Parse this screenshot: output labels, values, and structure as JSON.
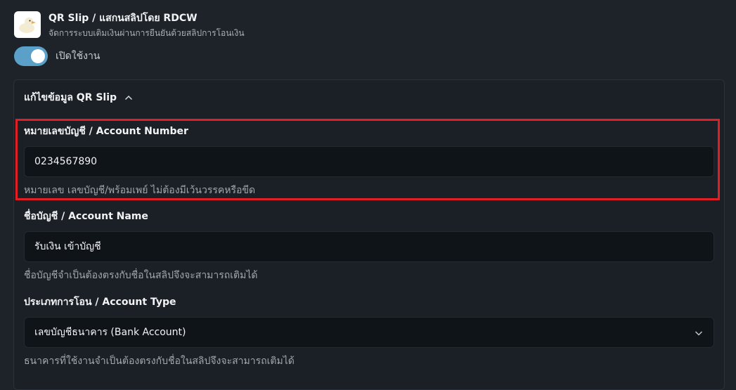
{
  "app": {
    "title": "QR Slip / แสกนสลิปโดย RDCW",
    "subtitle": "จัดการระบบเติมเงินผ่านการยืนยันด้วยสลิปการโอนเงิน",
    "logo_icon": "duck-logo-icon"
  },
  "toggle": {
    "label": "เปิดใช้งาน",
    "state": "on",
    "accent": "#5aa0c8"
  },
  "panel": {
    "title": "แก้ไขข้อมูล QR Slip",
    "expanded": true
  },
  "fields": {
    "account_number": {
      "label": "หมายเลขบัญชี / Account Number",
      "value": "0234567890",
      "help": "หมายเลข เลขบัญชี/พร้อมเพย์ ไม่ต้องมีเว้นวรรคหรือขีด"
    },
    "account_name": {
      "label": "ชื่อบัญชี / Account Name",
      "value": "รับเงิน เข้าบัญชี",
      "help": "ชื่อบัญชีจำเป็นต้องตรงกับชื่อในสลิปจึงจะสามารถเติมได้"
    },
    "transfer_type": {
      "label": "ประเภทการโอน / Account Type",
      "value": "เลขบัญชีธนาคาร (Bank Account)",
      "help": "ธนาคารที่ใช้งานจำเป็นต้องตรงกับชื่อในสลิปจึงจะสามารถเติมได้"
    }
  },
  "colors": {
    "highlight_border": "#e01e24",
    "background": "#1d2329"
  }
}
